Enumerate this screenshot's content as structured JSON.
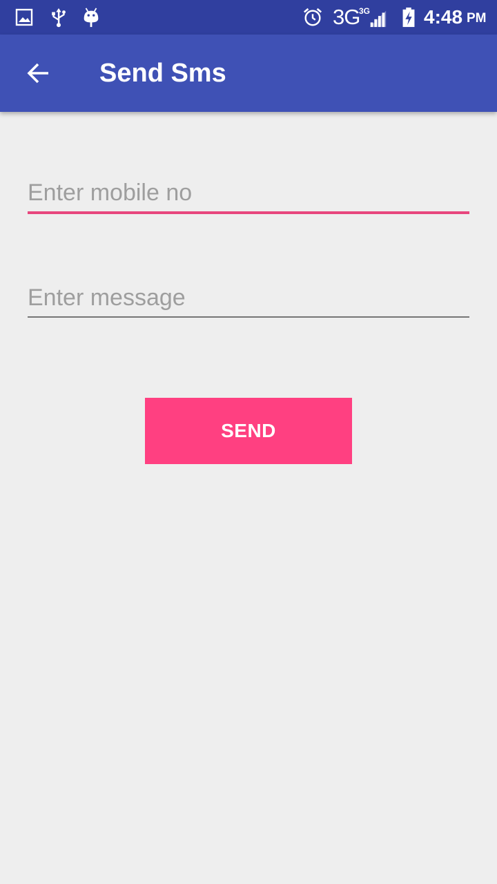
{
  "status_bar": {
    "background": "#303f9f",
    "left_icons": [
      "gallery-icon",
      "usb-icon",
      "android-debug-icon"
    ],
    "right_icons": [
      "alarm-icon",
      "signal-icon",
      "battery-charging-icon"
    ],
    "network": "3G",
    "network_superscript": "3G",
    "time": "4:48",
    "ampm": "PM"
  },
  "app_bar": {
    "background": "#3f51b5",
    "back_icon": "arrow-back-icon",
    "title": "Send Sms"
  },
  "form": {
    "mobile": {
      "value": "",
      "placeholder": "Enter mobile no",
      "focused": true,
      "underline_color": "#e7467d"
    },
    "message": {
      "value": "",
      "placeholder": "Enter message",
      "focused": false,
      "underline_color": "#757575"
    },
    "send_label": "SEND",
    "send_color": "#ff4081"
  }
}
